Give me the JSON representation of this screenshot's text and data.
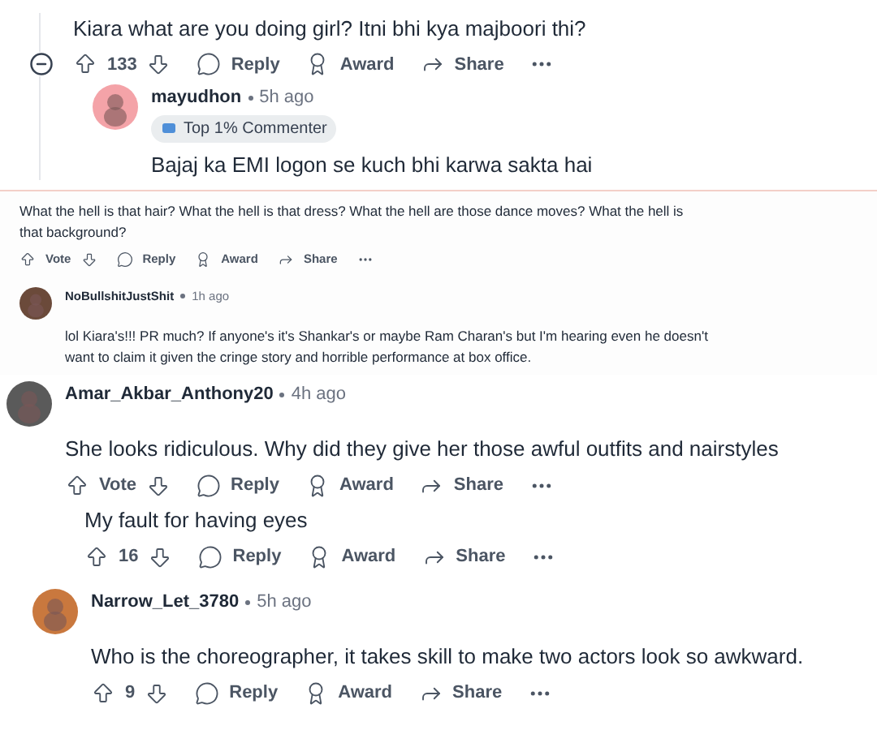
{
  "panels": [
    {
      "kind": "large",
      "comments": [
        {
          "text": "Kiara what are you doing girl? Itni bhi kya majboori thi?",
          "collapsible": true,
          "votes": "133",
          "actions": [
            "Reply",
            "Award",
            "Share"
          ],
          "replies": [
            {
              "author": "mayudhon",
              "time": "5h ago",
              "color": "#f4a3a8",
              "badge": "Top 1% Commenter",
              "text": "Bajaj ka EMI logon se kuch bhi karwa sakta hai"
            }
          ]
        }
      ]
    },
    {
      "kind": "small",
      "comments": [
        {
          "text": "What the hell is that hair? What the hell is that dress? What the hell are those dance moves? What the hell is that background?",
          "votes": "Vote",
          "actions": [
            "Reply",
            "Award",
            "Share"
          ]
        },
        {
          "author": "NoBullshitJustShit",
          "time": "1h ago",
          "color": "#6b4a3a",
          "text": "lol Kiara's!!! PR much? If anyone's it's Shankar's or maybe Ram Charan's but I'm hearing even he doesn't want to claim it given the cringe story and horrible performance at box office."
        }
      ]
    },
    {
      "kind": "large",
      "comments": [
        {
          "author": "Amar_Akbar_Anthony20",
          "time": "4h ago",
          "color": "#5a5a5a",
          "text": "She looks ridiculous. Why did they give her those awful outfits and nairstyles",
          "votes": "Vote",
          "actions": [
            "Reply",
            "Award",
            "Share"
          ],
          "replies": [
            {
              "text": "My fault for having eyes",
              "votes": "16",
              "actions": [
                "Reply",
                "Award",
                "Share"
              ]
            }
          ]
        },
        {
          "author": "Narrow_Let_3780",
          "time": "5h ago",
          "color": "#c9783e",
          "text": "Who is the choreographer, it takes skill to make two actors look so awkward.",
          "votes": "9",
          "actions": [
            "Reply",
            "Award",
            "Share"
          ]
        }
      ]
    }
  ]
}
